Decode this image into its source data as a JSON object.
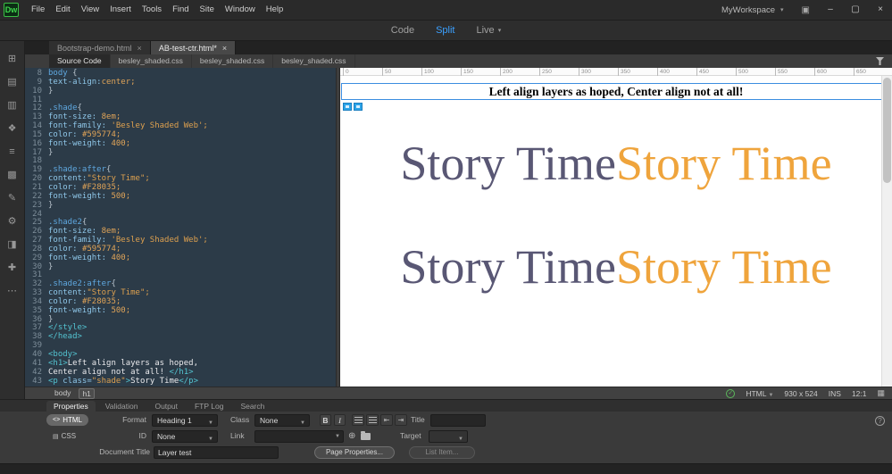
{
  "app": {
    "logo_text": "Dw",
    "menus": [
      "File",
      "Edit",
      "View",
      "Insert",
      "Tools",
      "Find",
      "Site",
      "Window",
      "Help"
    ],
    "workspace_label": "MyWorkspace",
    "minimize": "–",
    "maximize": "▢",
    "close": "×"
  },
  "view_toolbar": {
    "modes": [
      "Code",
      "Split",
      "Live"
    ],
    "active": "Split"
  },
  "tabs": [
    {
      "label": "Bootstrap-demo.html",
      "close": "×",
      "active": false
    },
    {
      "label": "AB-test-ctr.html*",
      "close": "×",
      "active": true
    }
  ],
  "related_files": {
    "items": [
      "Source Code",
      "besley_shaded.css",
      "besley_shaded.css",
      "besley_shaded.css"
    ],
    "active_index": 0
  },
  "left_rail_icons": [
    {
      "name": "insert-panel-icon",
      "glyph": "⊞"
    },
    {
      "name": "files-panel-icon",
      "glyph": "▤"
    },
    {
      "name": "cc-libraries-panel-icon",
      "glyph": "▥"
    },
    {
      "name": "css-designer-panel-icon",
      "glyph": "❖"
    },
    {
      "name": "dom-panel-icon",
      "glyph": "≡"
    },
    {
      "name": "assets-panel-icon",
      "glyph": "▩"
    },
    {
      "name": "snippets-panel-icon",
      "glyph": "✎"
    },
    {
      "name": "behaviors-panel-icon",
      "glyph": "⚙"
    },
    {
      "name": "extract-panel-icon",
      "glyph": "◨"
    },
    {
      "name": "linting-panel-icon",
      "glyph": "✚"
    },
    {
      "name": "more-panels-icon",
      "glyph": "⋯"
    }
  ],
  "code_editor": {
    "lines": [
      {
        "n": 8,
        "t": [
          [
            "sel",
            "body"
          ],
          [
            "pun",
            " {"
          ]
        ]
      },
      {
        "n": 9,
        "t": [
          [
            "prop",
            "text-align:"
          ],
          [
            "val",
            "center;"
          ]
        ]
      },
      {
        "n": 10,
        "t": [
          [
            "pun",
            "}"
          ]
        ]
      },
      {
        "n": 11,
        "t": []
      },
      {
        "n": 12,
        "t": [
          [
            "sel",
            ".shade"
          ],
          [
            "pun",
            "{"
          ]
        ]
      },
      {
        "n": 13,
        "t": [
          [
            "prop",
            "font-size: "
          ],
          [
            "val",
            "8em;"
          ]
        ]
      },
      {
        "n": 14,
        "t": [
          [
            "prop",
            "font-family: "
          ],
          [
            "str",
            "'Besley Shaded Web';"
          ]
        ]
      },
      {
        "n": 15,
        "t": [
          [
            "prop",
            "color: "
          ],
          [
            "val",
            "#595774;"
          ]
        ]
      },
      {
        "n": 16,
        "t": [
          [
            "prop",
            "font-weight: "
          ],
          [
            "val",
            "400;"
          ]
        ]
      },
      {
        "n": 17,
        "t": [
          [
            "pun",
            "}"
          ]
        ]
      },
      {
        "n": 18,
        "t": []
      },
      {
        "n": 19,
        "t": [
          [
            "sel",
            ".shade:after"
          ],
          [
            "pun",
            "{"
          ]
        ]
      },
      {
        "n": 20,
        "t": [
          [
            "prop",
            "content:"
          ],
          [
            "str",
            "\"Story Time\";"
          ]
        ]
      },
      {
        "n": 21,
        "t": [
          [
            "prop",
            "color: "
          ],
          [
            "val",
            "#F28035;"
          ]
        ]
      },
      {
        "n": 22,
        "t": [
          [
            "prop",
            "font-weight: "
          ],
          [
            "val",
            "500;"
          ]
        ]
      },
      {
        "n": 23,
        "t": [
          [
            "pun",
            "}"
          ]
        ]
      },
      {
        "n": 24,
        "t": []
      },
      {
        "n": 25,
        "t": [
          [
            "sel",
            ".shade2"
          ],
          [
            "pun",
            "{"
          ]
        ]
      },
      {
        "n": 26,
        "t": [
          [
            "prop",
            "font-size: "
          ],
          [
            "val",
            "8em;"
          ]
        ]
      },
      {
        "n": 27,
        "t": [
          [
            "prop",
            "font-family: "
          ],
          [
            "str",
            "'Besley Shaded Web';"
          ]
        ]
      },
      {
        "n": 28,
        "t": [
          [
            "prop",
            "color: "
          ],
          [
            "val",
            "#595774;"
          ]
        ]
      },
      {
        "n": 29,
        "t": [
          [
            "prop",
            "font-weight: "
          ],
          [
            "val",
            "400;"
          ]
        ]
      },
      {
        "n": 30,
        "t": [
          [
            "pun",
            "}"
          ]
        ]
      },
      {
        "n": 31,
        "t": []
      },
      {
        "n": 32,
        "t": [
          [
            "sel",
            ".shade2:after"
          ],
          [
            "pun",
            "{"
          ]
        ]
      },
      {
        "n": 33,
        "t": [
          [
            "prop",
            "content:"
          ],
          [
            "str",
            "\"Story Time\";"
          ]
        ]
      },
      {
        "n": 34,
        "t": [
          [
            "prop",
            "color: "
          ],
          [
            "val",
            "#F28035;"
          ]
        ]
      },
      {
        "n": 35,
        "t": [
          [
            "prop",
            "font-weight: "
          ],
          [
            "val",
            "500;"
          ]
        ]
      },
      {
        "n": 36,
        "t": [
          [
            "pun",
            "}"
          ]
        ]
      },
      {
        "n": 37,
        "t": [
          [
            "tag",
            "</style>"
          ]
        ]
      },
      {
        "n": 38,
        "t": [
          [
            "tag",
            "</head>"
          ]
        ]
      },
      {
        "n": 39,
        "t": []
      },
      {
        "n": 40,
        "t": [
          [
            "tag",
            "<body>"
          ]
        ]
      },
      {
        "n": 41,
        "t": [
          [
            "tag",
            "<h1>"
          ],
          [
            "txt",
            "Left align layers as hoped,"
          ]
        ]
      },
      {
        "n": 42,
        "t": [
          [
            "txt",
            "Center align not at all! "
          ],
          [
            "tag",
            "</h1>"
          ]
        ]
      },
      {
        "n": 43,
        "t": [
          [
            "tag",
            "<p"
          ],
          [
            "prop",
            " class="
          ],
          [
            "str",
            "\"shade\""
          ],
          [
            "tag",
            ">"
          ],
          [
            "txt",
            "Story Time"
          ],
          [
            "tag",
            "</p>"
          ]
        ]
      }
    ]
  },
  "design_view": {
    "ruler_numbers": [
      "0",
      "50",
      "100",
      "150",
      "200",
      "250",
      "300",
      "350",
      "400",
      "450",
      "500",
      "550",
      "600",
      "650"
    ],
    "heading_text": "Left align layers as hoped, Center align not at all!",
    "story_rows": [
      {
        "left": "Story Time",
        "right": "Story Time"
      },
      {
        "left": "Story Time",
        "right": "Story Time"
      }
    ],
    "colors": {
      "left_text": "#595774",
      "right_text": "#EFA43C",
      "selection_border": "#3B8DE0"
    }
  },
  "status_bar": {
    "tag_path": [
      "body",
      "h1"
    ],
    "lint_icon": "✓",
    "doctype": "HTML",
    "dimensions": "930 x 524",
    "insert_mode": "INS",
    "cursor_position": "12:1",
    "size_presets_icon": "▦"
  },
  "properties_panel": {
    "tabs": [
      "Properties",
      "Validation",
      "Output",
      "FTP Log",
      "Search"
    ],
    "active_tab": "Properties",
    "html_toggle": "HTML",
    "css_toggle": "CSS",
    "format_label": "Format",
    "format_value": "Heading 1",
    "id_label": "ID",
    "id_value": "None",
    "class_label": "Class",
    "class_value": "None",
    "bold_label": "B",
    "italic_label": "I",
    "link_label": "Link",
    "title_label": "Title",
    "target_label": "Target",
    "document_title_label": "Document Title",
    "document_title_value": "Layer test",
    "page_properties_button": "Page Properties...",
    "list_item_button": "List Item..."
  }
}
